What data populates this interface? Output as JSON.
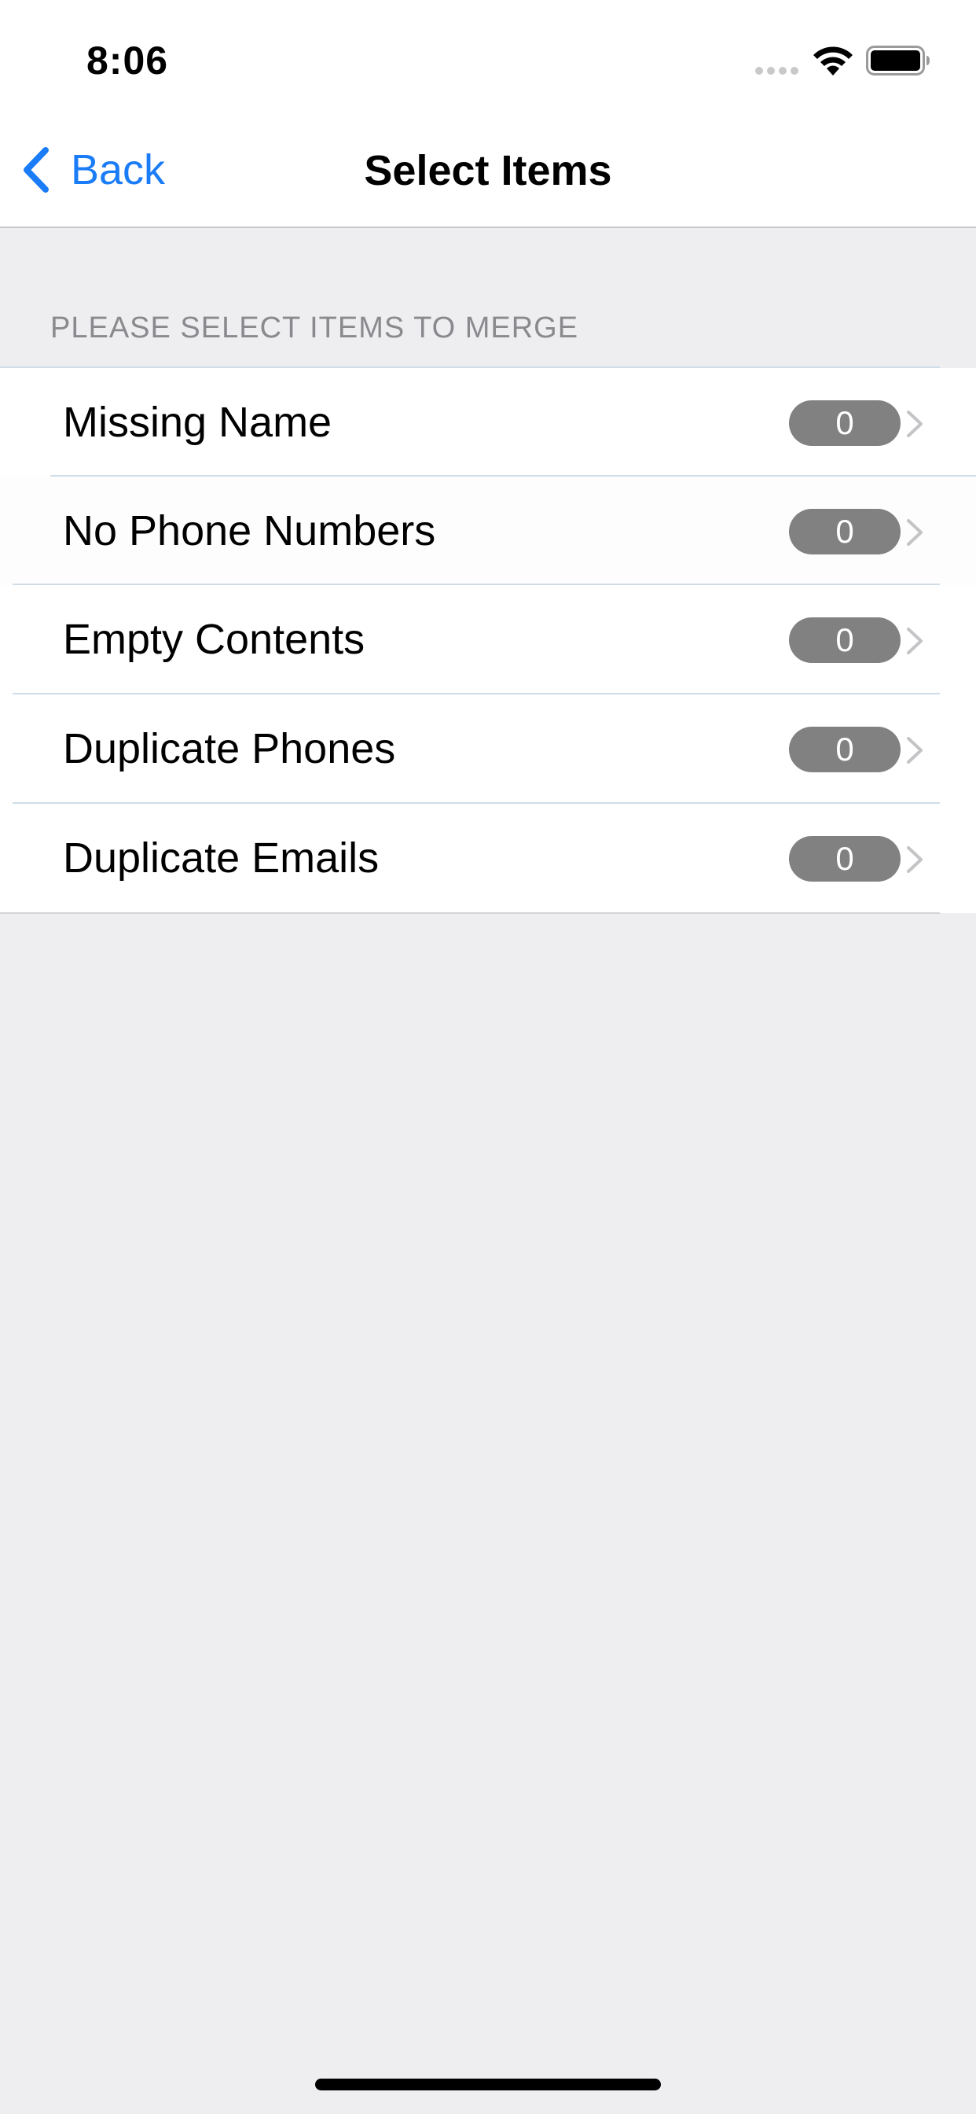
{
  "status_bar": {
    "time": "8:06"
  },
  "nav_bar": {
    "back_label": "Back",
    "title": "Select Items"
  },
  "section": {
    "header": "PLEASE SELECT ITEMS TO MERGE"
  },
  "items": [
    {
      "label": "Missing Name",
      "count": "0"
    },
    {
      "label": "No Phone Numbers",
      "count": "0"
    },
    {
      "label": "Empty Contents",
      "count": "0"
    },
    {
      "label": "Duplicate Phones",
      "count": "0"
    },
    {
      "label": "Duplicate Emails",
      "count": "0"
    }
  ],
  "colors": {
    "accent": "#1a7cf6",
    "badge": "#818181",
    "background": "#eeeef0"
  },
  "icons": [
    "wifi-icon",
    "battery-icon",
    "back-chevron-icon",
    "chevron-right-icon"
  ]
}
